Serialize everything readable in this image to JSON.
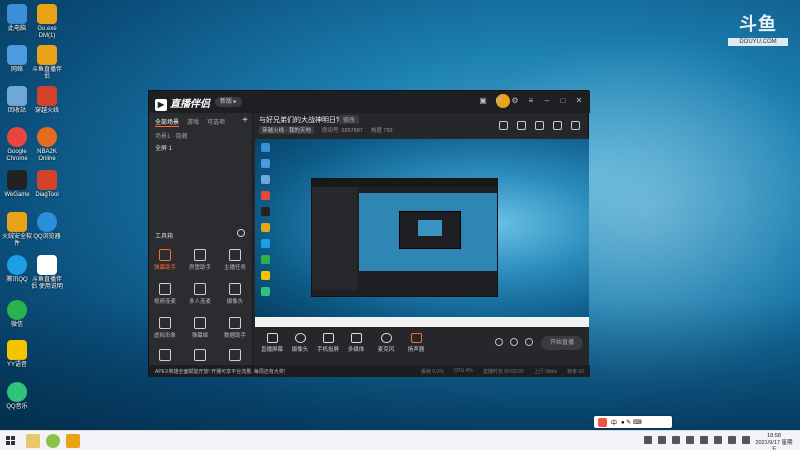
{
  "desktop": {
    "icons": [
      {
        "label": "此电脑",
        "color": "#3a8fd6"
      },
      {
        "label": "Go.exe\nDM(1)",
        "color": "#e8a317"
      },
      {
        "label": "网络",
        "color": "#4a9be0"
      },
      {
        "label": "斗鱼直播伴侣",
        "color": "#e8a317"
      },
      {
        "label": "回收站",
        "color": "#6fa8d6"
      },
      {
        "label": "穿越火线",
        "color": "#d4412a"
      },
      {
        "label": "Google\nChrome",
        "color": "#e8453c"
      },
      {
        "label": "NBA2K\nOnline",
        "color": "#e56b1f"
      },
      {
        "label": "WeGame",
        "color": "#222222"
      },
      {
        "label": "DiagTool",
        "color": "#d3432a"
      },
      {
        "label": "火绒安全软件",
        "color": "#e8a317"
      },
      {
        "label": "QQ浏览器",
        "color": "#2c8fdc"
      },
      {
        "label": "腾讯QQ",
        "color": "#1ba0e6"
      },
      {
        "label": "斗鱼直播伴侣\n使用说明",
        "color": "#ffffff"
      },
      {
        "label": "微信",
        "color": "#2bb24c"
      },
      {
        "label": "YY语音",
        "color": "#f5c400"
      },
      {
        "label": "QQ音乐",
        "color": "#31c27c"
      }
    ],
    "brand_mark": "斗鱼",
    "brand_sub": "DOUYU.COM"
  },
  "app": {
    "logo": "直播伴侣",
    "version_pill": "新版 ▸",
    "title_actions": [
      "皮肤",
      "消息",
      "设置",
      "菜单",
      "最小化",
      "最大化",
      "关闭"
    ],
    "tabs": [
      "全部场景",
      "游戏",
      "可选项"
    ],
    "add_label": "+",
    "scenes": [
      "场景1 · 隐藏",
      "全屏 1"
    ],
    "tools_title": "工具箱",
    "tools": [
      {
        "label": "弹幕助手",
        "hot": true
      },
      {
        "label": "房管助手",
        "hot": false
      },
      {
        "label": "主播任务",
        "hot": false
      },
      {
        "label": "视频连麦",
        "hot": false
      },
      {
        "label": "多人连麦",
        "hot": false
      },
      {
        "label": "摄像头",
        "hot": false
      },
      {
        "label": "虚拟形象",
        "hot": false
      },
      {
        "label": "弹幕姬",
        "hot": false
      },
      {
        "label": "数据助手",
        "hot": false
      },
      {
        "label": "PK",
        "hot": false
      },
      {
        "label": "下载",
        "hot": false
      },
      {
        "label": "更多",
        "hot": false
      }
    ],
    "stream_title": "与好兄弟们的大战神明日常!",
    "edit_label": "修改",
    "room": {
      "category": "穿越火线 · 我的天地",
      "room_id": "房间号: 9257887",
      "hot": "热度 793"
    },
    "bottom_tools": [
      "直播屏幕",
      "摄像头",
      "手机投屏",
      "多媒体",
      "麦克风",
      "扬声器"
    ],
    "start_label": "开始直播",
    "notice": "APEX英雄全面赋能开放! 开播可享平台流量, 每周还有大奖!",
    "stats": [
      "丢帧 0.0%",
      "CPU 4%",
      "直播时长 00:00:00",
      "上行 0kb/s",
      "帧率 60"
    ]
  },
  "taskbar": {
    "time": "18:58",
    "date": "2021/9/17 星期五",
    "ime": "中"
  }
}
